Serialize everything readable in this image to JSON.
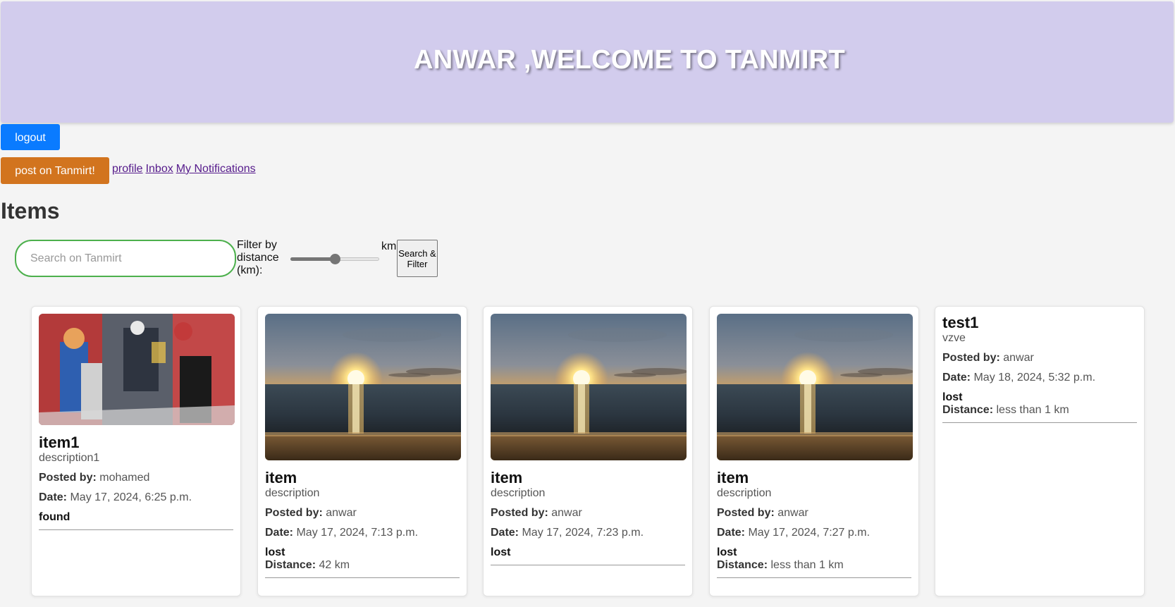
{
  "header": {
    "title": "ANWAR ,WELCOME TO TANMIRT"
  },
  "actions": {
    "logout_label": "logout",
    "post_label": "post on Tanmirt!"
  },
  "nav": {
    "profile": "profile",
    "inbox": "Inbox",
    "notifications": "My Notifications"
  },
  "items_heading": "Items",
  "search": {
    "placeholder": "Search on Tanmirt",
    "value": "",
    "filter_label": "Filter by distance (km):",
    "distance_value_fraction": 0.5,
    "unit": "km",
    "button_label": "Search & Filter"
  },
  "labels": {
    "posted_by": "Posted by:",
    "date": "Date:",
    "distance": "Distance:"
  },
  "cards": [
    {
      "title": "item1",
      "description": "description1",
      "posted_by": "mohamed",
      "date": "May 17, 2024, 6:25 p.m.",
      "status": "found",
      "distance": "",
      "image": "anime-collage"
    },
    {
      "title": "item",
      "description": "description",
      "posted_by": "anwar",
      "date": "May 17, 2024, 7:13 p.m.",
      "status": "lost",
      "distance": "42 km",
      "image": "sunset-beach"
    },
    {
      "title": "item",
      "description": "description",
      "posted_by": "anwar",
      "date": "May 17, 2024, 7:23 p.m.",
      "status": "lost",
      "distance": "",
      "image": "sunset-beach"
    },
    {
      "title": "item",
      "description": "description",
      "posted_by": "anwar",
      "date": "May 17, 2024, 7:27 p.m.",
      "status": "lost",
      "distance": "less than 1 km",
      "image": "sunset-beach"
    },
    {
      "title": "test1",
      "description": "vzve",
      "posted_by": "anwar",
      "date": "May 18, 2024, 5:32 p.m.",
      "status": "lost",
      "distance": "less than 1 km",
      "image": ""
    }
  ],
  "colors": {
    "header_bg": "#d2cced",
    "logout_bg": "#0a7bff",
    "post_bg": "#d2741e",
    "search_border": "#4cb04c",
    "link": "#551a8b"
  }
}
